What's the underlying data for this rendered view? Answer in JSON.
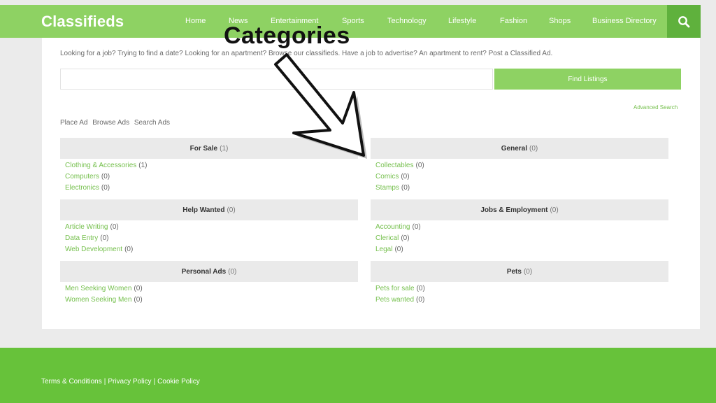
{
  "header": {
    "brand": "Classifieds",
    "nav": [
      "Home",
      "News",
      "Entertainment",
      "Sports",
      "Technology",
      "Lifestyle",
      "Fashion",
      "Shops",
      "Business Directory"
    ],
    "search_icon": "search-icon"
  },
  "main": {
    "intro": "Looking for a job? Trying to find a date? Looking for an apartment? Browse our classifieds. Have a job to advertise? An apartment to rent? Post a Classified Ad.",
    "search_value": "",
    "find_button": "Find Listings",
    "advanced_search": "Advanced Search",
    "actions": [
      "Place Ad",
      "Browse Ads",
      "Search Ads"
    ],
    "categories": [
      {
        "name": "For Sale",
        "count": "(1)",
        "items": [
          {
            "label": "Clothing & Accessories",
            "count": "(1)"
          },
          {
            "label": "Computers",
            "count": "(0)"
          },
          {
            "label": "Electronics",
            "count": "(0)"
          }
        ]
      },
      {
        "name": "General",
        "count": "(0)",
        "items": [
          {
            "label": "Collectables",
            "count": "(0)"
          },
          {
            "label": "Comics",
            "count": "(0)"
          },
          {
            "label": "Stamps",
            "count": "(0)"
          }
        ]
      },
      {
        "name": "Help Wanted",
        "count": "(0)",
        "items": [
          {
            "label": "Article Writing",
            "count": "(0)"
          },
          {
            "label": "Data Entry",
            "count": "(0)"
          },
          {
            "label": "Web Development",
            "count": "(0)"
          }
        ]
      },
      {
        "name": "Jobs & Employment",
        "count": "(0)",
        "items": [
          {
            "label": "Accounting",
            "count": "(0)"
          },
          {
            "label": "Clerical",
            "count": "(0)"
          },
          {
            "label": "Legal",
            "count": "(0)"
          }
        ]
      },
      {
        "name": "Personal Ads",
        "count": "(0)",
        "items": [
          {
            "label": "Men Seeking Women",
            "count": "(0)"
          },
          {
            "label": "Women Seeking Men",
            "count": "(0)"
          }
        ]
      },
      {
        "name": "Pets",
        "count": "(0)",
        "items": [
          {
            "label": "Pets for sale",
            "count": "(0)"
          },
          {
            "label": "Pets wanted",
            "count": "(0)"
          }
        ]
      }
    ]
  },
  "footer": {
    "links": [
      "Terms & Conditions",
      "Privacy Policy",
      "Cookie Policy"
    ],
    "separator": "|"
  },
  "overlay": {
    "title": "Categories",
    "arrow_icon": "arrow-down-right-icon"
  },
  "colors": {
    "header": "#8ed263",
    "search_button": "#5fb13d",
    "footer": "#67c23a",
    "link": "#76c04e",
    "category_header": "#eaeaea"
  }
}
